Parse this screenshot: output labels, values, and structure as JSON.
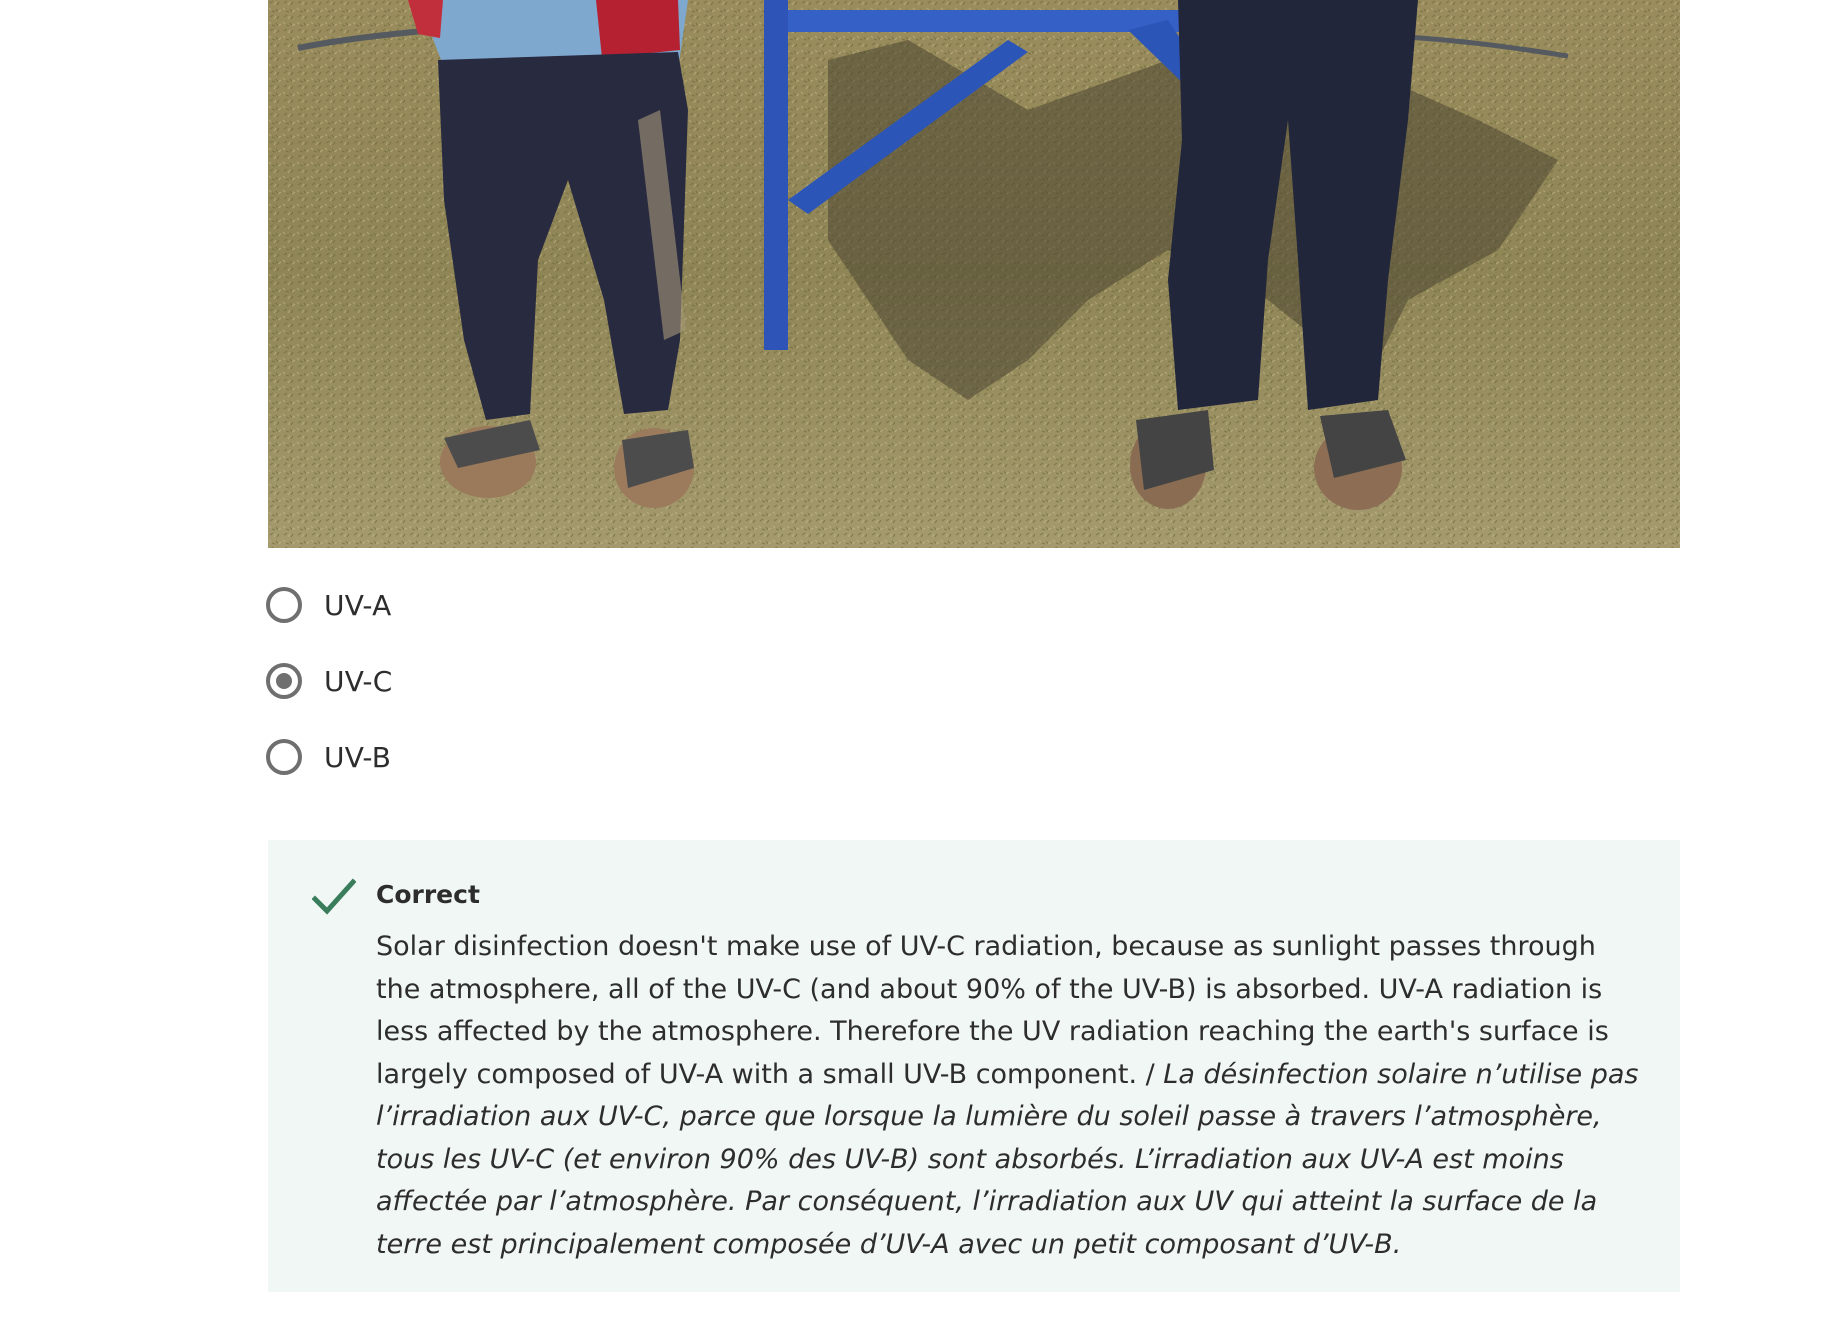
{
  "photo": {
    "alt_icon": "photo-of-solar-disinfection-stand"
  },
  "question": {
    "options": [
      {
        "label": "UV-A",
        "selected": false
      },
      {
        "label": "UV-C",
        "selected": true
      },
      {
        "label": "UV-B",
        "selected": false
      }
    ]
  },
  "feedback": {
    "status_icon": "check-icon",
    "title": "Correct",
    "text_en": "Solar disinfection doesn't make use of UV-C radiation, because as sunlight passes through the atmosphere, all of the UV-C (and about 90% of the UV-B) is absorbed. UV-A radiation is less affected by the atmosphere. Therefore the UV radiation reaching the earth's surface is largely composed of UV-A with a small UV-B component. /",
    "text_fr": "La désinfection solaire n’utilise pas l’irradiation aux UV-C, parce que lorsque la lumière du soleil passe à travers l’atmosphère, tous les UV-C (et environ 90% des UV-B) sont absorbés. L’irradiation aux UV-A est moins affectée par l’atmosphère. Par conséquent, l’irradiation aux UV qui atteint la surface de la terre est principalement composée d’UV-A avec un petit composant d’UV-B.",
    "check_color": "#3a7d5c",
    "background": "#f1f7f4"
  }
}
